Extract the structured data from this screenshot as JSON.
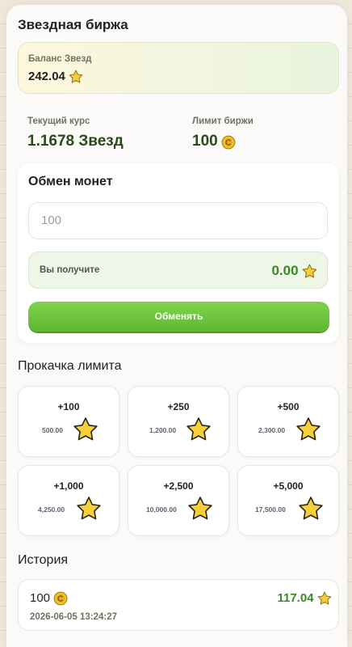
{
  "page": {
    "title": "Звездная биржа"
  },
  "balance": {
    "label": "Баланс Звезд",
    "value": "242.04"
  },
  "stats": {
    "rate_label": "Текущий курс",
    "rate_value": "1.1678 Звезд",
    "limit_label": "Лимит биржи",
    "limit_value": "100"
  },
  "exchange": {
    "title": "Обмен монет",
    "input_value": "100",
    "receive_label": "Вы получите",
    "receive_value": "0.00",
    "button_label": "Обменять"
  },
  "upgrade": {
    "title": "Прокачка лимита",
    "packages": [
      {
        "amount": "+100",
        "price": "500.00"
      },
      {
        "amount": "+250",
        "price": "1,200.00"
      },
      {
        "amount": "+500",
        "price": "2,300.00"
      },
      {
        "amount": "+1,000",
        "price": "4,250.00"
      },
      {
        "amount": "+2,500",
        "price": "10,000.00"
      },
      {
        "amount": "+5,000",
        "price": "17,500.00"
      }
    ]
  },
  "history": {
    "title": "История",
    "items": [
      {
        "coins": "100",
        "stars": "117.04",
        "date": "2026-06-05 13:24:27"
      }
    ]
  },
  "icons": {
    "star": "star-icon",
    "coin": "coin-icon"
  },
  "colors": {
    "accent_green": "#5fb832",
    "value_green": "#3a8a22",
    "star_yellow": "#f6d038",
    "coin_gold": "#e6b21c"
  }
}
